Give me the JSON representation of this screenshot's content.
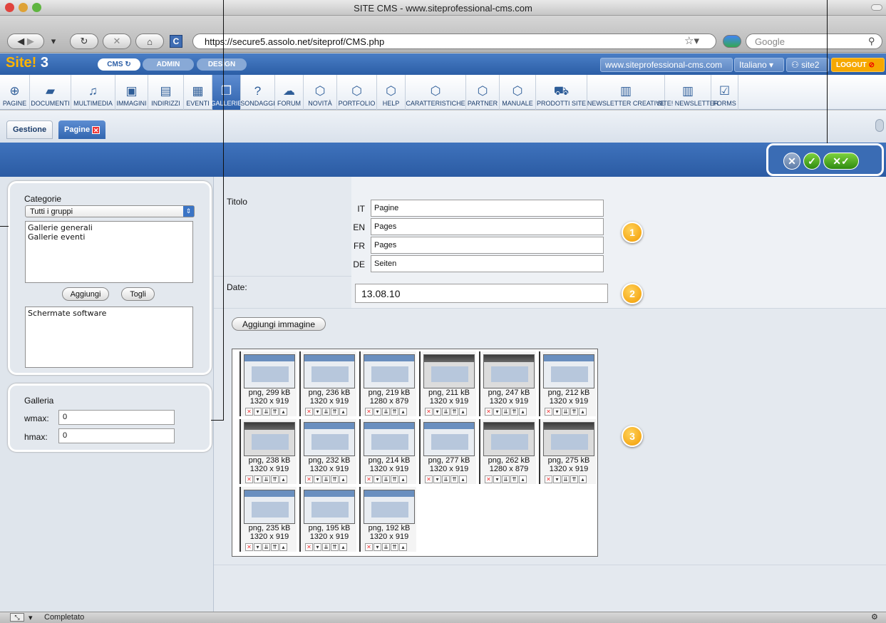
{
  "window": {
    "title": "SITE CMS - www.siteprofessional-cms.com"
  },
  "browser": {
    "url": "https://secure5.assolo.net/siteprof/CMS.php",
    "search_placeholder": "Google"
  },
  "cms_header": {
    "logo_main": "Site!",
    "logo_version": "3",
    "modes": [
      "CMS",
      "ADMIN",
      "DESIGN"
    ],
    "site_url": "www.siteprofessional-cms.com",
    "language": "Italiano",
    "user": "site2",
    "logout": "LOGOUT"
  },
  "toolbar": [
    {
      "label": "PAGINE",
      "icon": "globe-icon",
      "glyph": "⊕"
    },
    {
      "label": "DOCUMENTI",
      "icon": "folder-icon",
      "glyph": "▰"
    },
    {
      "label": "MULTIMEDIA",
      "icon": "multimedia-icon",
      "glyph": "♫"
    },
    {
      "label": "IMMAGINI",
      "icon": "image-icon",
      "glyph": "▣"
    },
    {
      "label": "INDIRIZZI",
      "icon": "address-icon",
      "glyph": "▤"
    },
    {
      "label": "EVENTI",
      "icon": "calendar-icon",
      "glyph": "▦"
    },
    {
      "label": "GALLERIE",
      "icon": "gallery-icon",
      "glyph": "❐"
    },
    {
      "label": "SONDAGGI",
      "icon": "poll-icon",
      "glyph": "?"
    },
    {
      "label": "FORUM",
      "icon": "forum-icon",
      "glyph": "☁"
    },
    {
      "label": "NOVITÀ",
      "icon": "box-icon",
      "glyph": "⬡"
    },
    {
      "label": "PORTFOLIO",
      "icon": "box-icon",
      "glyph": "⬡"
    },
    {
      "label": "HELP",
      "icon": "box-icon",
      "glyph": "⬡"
    },
    {
      "label": "CARATTERISTICHE",
      "icon": "box-icon",
      "glyph": "⬡"
    },
    {
      "label": "PARTNER",
      "icon": "box-icon",
      "glyph": "⬡"
    },
    {
      "label": "MANUALE",
      "icon": "box-icon",
      "glyph": "⬡"
    },
    {
      "label": "PRODOTTI SITE",
      "icon": "cart-icon",
      "glyph": "⛟"
    },
    {
      "label": "NEWSLETTER CREATIVE",
      "icon": "newsletter-icon",
      "glyph": "▥"
    },
    {
      "label": "SITE! NEWSLETTER",
      "icon": "newsletter-icon",
      "glyph": "▥"
    },
    {
      "label": "FORMS",
      "icon": "checkbox-icon",
      "glyph": "☑"
    }
  ],
  "tabs": {
    "gestione": "Gestione",
    "pagine": "Pagine"
  },
  "left_panel": {
    "categorie_label": "Categorie",
    "group_select": "Tutti i gruppi",
    "available": [
      "Gallerie generali",
      "Gallerie eventi"
    ],
    "add_btn": "Aggiungi",
    "remove_btn": "Togli",
    "assigned": [
      "Schermate software"
    ],
    "galleria_label": "Galleria",
    "wmax_label": "wmax:",
    "wmax": "0",
    "hmax_label": "hmax:",
    "hmax": "0"
  },
  "form": {
    "titolo_label": "Titolo",
    "titles": [
      {
        "lang": "IT",
        "value": "Pagine"
      },
      {
        "lang": "EN",
        "value": "Pages"
      },
      {
        "lang": "FR",
        "value": "Pages"
      },
      {
        "lang": "DE",
        "value": "Seiten"
      }
    ],
    "date_label": "Date:",
    "date": "13.08.10",
    "add_image_btn": "Aggiungi immagine",
    "badges": [
      "1",
      "2",
      "3"
    ]
  },
  "images": [
    {
      "size": "png, 299 kB",
      "dim": "1320 x 919"
    },
    {
      "size": "png, 236 kB",
      "dim": "1320 x 919"
    },
    {
      "size": "png, 219 kB",
      "dim": "1280 x 879"
    },
    {
      "size": "png, 211 kB",
      "dim": "1320 x 919"
    },
    {
      "size": "png, 247 kB",
      "dim": "1320 x 919"
    },
    {
      "size": "png, 212 kB",
      "dim": "1320 x 919"
    },
    {
      "size": "png, 238 kB",
      "dim": "1320 x 919"
    },
    {
      "size": "png, 232 kB",
      "dim": "1320 x 919"
    },
    {
      "size": "png, 214 kB",
      "dim": "1320 x 919"
    },
    {
      "size": "png, 277 kB",
      "dim": "1320 x 919"
    },
    {
      "size": "png, 262 kB",
      "dim": "1280 x 879"
    },
    {
      "size": "png, 275 kB",
      "dim": "1320 x 919"
    },
    {
      "size": "png, 235 kB",
      "dim": "1320 x 919"
    },
    {
      "size": "png, 195 kB",
      "dim": "1320 x 919"
    },
    {
      "size": "png, 192 kB",
      "dim": "1320 x 919"
    }
  ],
  "status": {
    "text": "Completato"
  }
}
